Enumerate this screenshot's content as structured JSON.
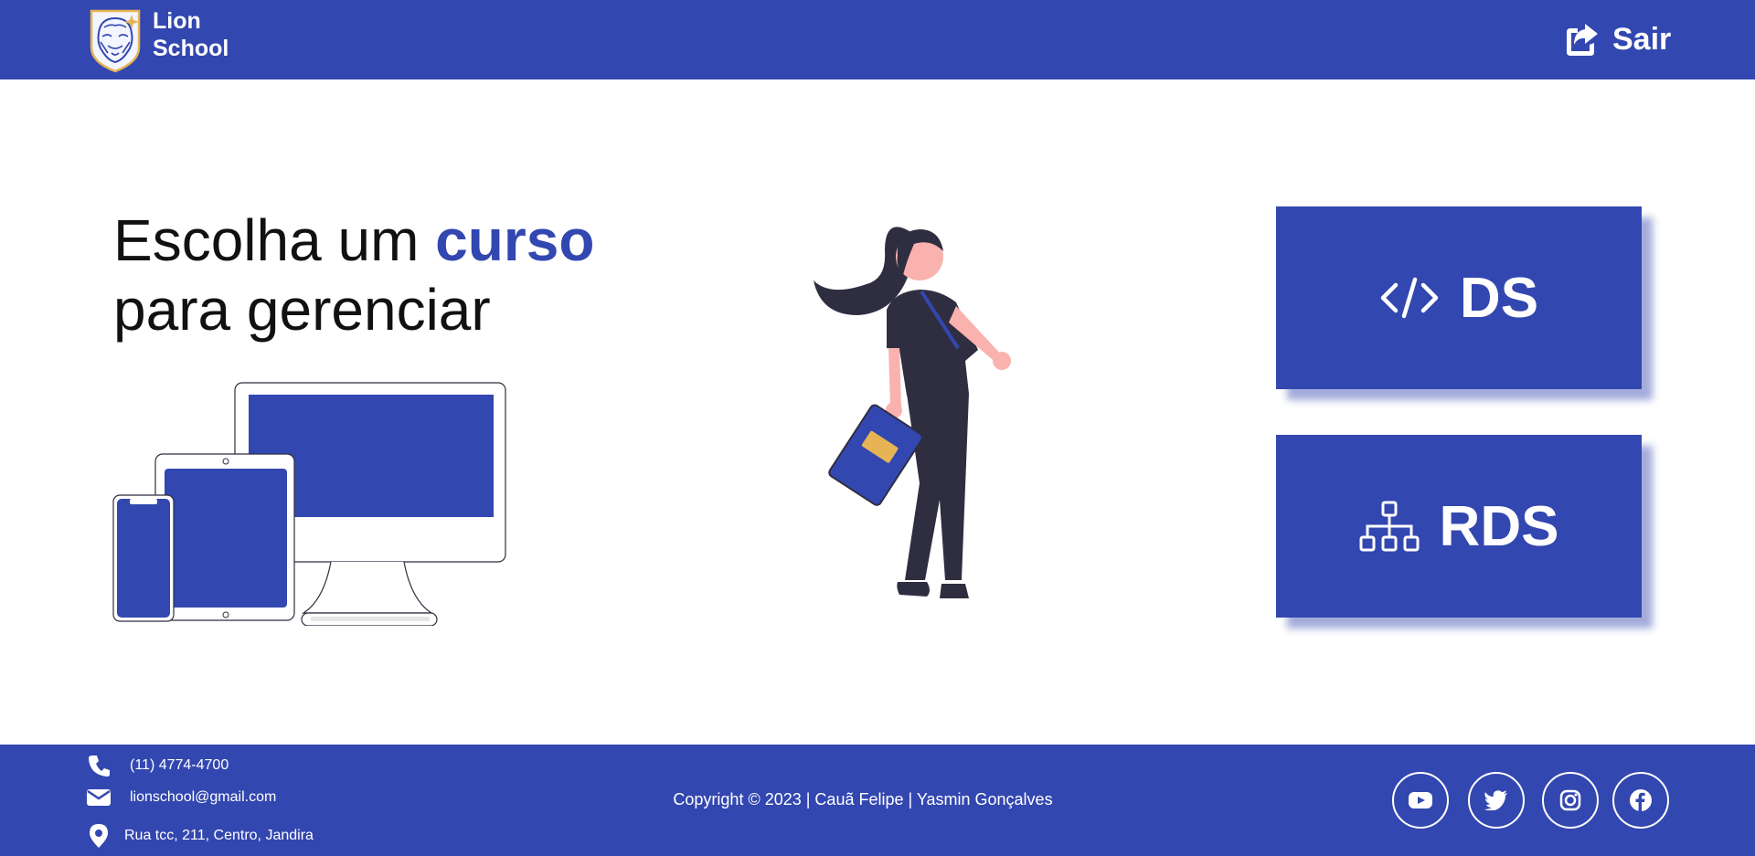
{
  "header": {
    "brand_line1": "Lion",
    "brand_line2": "School",
    "logout_label": "Sair",
    "logout_icon": "share-square-icon",
    "logo_icon": "lion-shield-logo"
  },
  "main": {
    "headline_part1": "Escolha um ",
    "headline_highlight": "curso",
    "headline_part2": "para gerenciar",
    "illustrations": [
      "devices-illustration",
      "girl-with-book-illustration"
    ],
    "courses": [
      {
        "label": "DS",
        "icon": "code-icon"
      },
      {
        "label": "RDS",
        "icon": "sitemap-icon"
      }
    ]
  },
  "footer": {
    "phone": "(11) 4774-4700",
    "email": "lionschool@gmail.com",
    "address": "Rua tcc, 211, Centro, Jandira",
    "copyright": "Copyright © 2023 | Cauã Felipe | Yasmin Gonçalves",
    "social": [
      "youtube-icon",
      "twitter-icon",
      "instagram-icon",
      "facebook-icon"
    ]
  },
  "colors": {
    "primary": "#3347b0",
    "text": "#111111",
    "white": "#ffffff",
    "skin": "#f9b2ae",
    "dark": "#2f2e41",
    "accent_yellow": "#e6b454"
  }
}
